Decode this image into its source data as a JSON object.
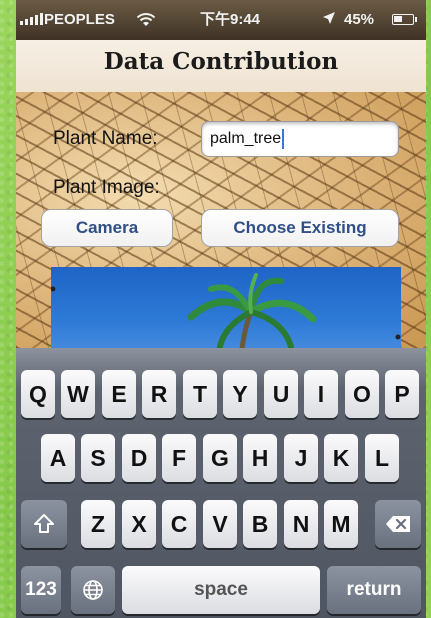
{
  "status_bar": {
    "carrier": "PEOPLES",
    "time": "下午9:44",
    "battery_percent": "45%",
    "battery_level": 0.45,
    "icons": [
      "signal-bars-icon",
      "wifi-icon",
      "location-arrow-icon",
      "battery-icon"
    ]
  },
  "header": {
    "title": "Data Contribution"
  },
  "form": {
    "plant_name_label": "Plant Name:",
    "plant_name_value": "palm_tree",
    "plant_image_label": "Plant Image:",
    "camera_button": "Camera",
    "choose_existing_button": "Choose Existing"
  },
  "keyboard": {
    "row1": [
      "Q",
      "W",
      "E",
      "R",
      "T",
      "Y",
      "U",
      "I",
      "O",
      "P"
    ],
    "row2": [
      "A",
      "S",
      "D",
      "F",
      "G",
      "H",
      "J",
      "K",
      "L"
    ],
    "row3": [
      "Z",
      "X",
      "C",
      "V",
      "B",
      "N",
      "M"
    ],
    "numbers_key": "123",
    "space_key": "space",
    "return_key": "return",
    "icons": [
      "shift-icon",
      "backspace-icon",
      "globe-icon"
    ]
  },
  "colors": {
    "button_text": "#2f4f86",
    "frame_green": "#8fd14f",
    "input_caret": "#3a77d8"
  }
}
